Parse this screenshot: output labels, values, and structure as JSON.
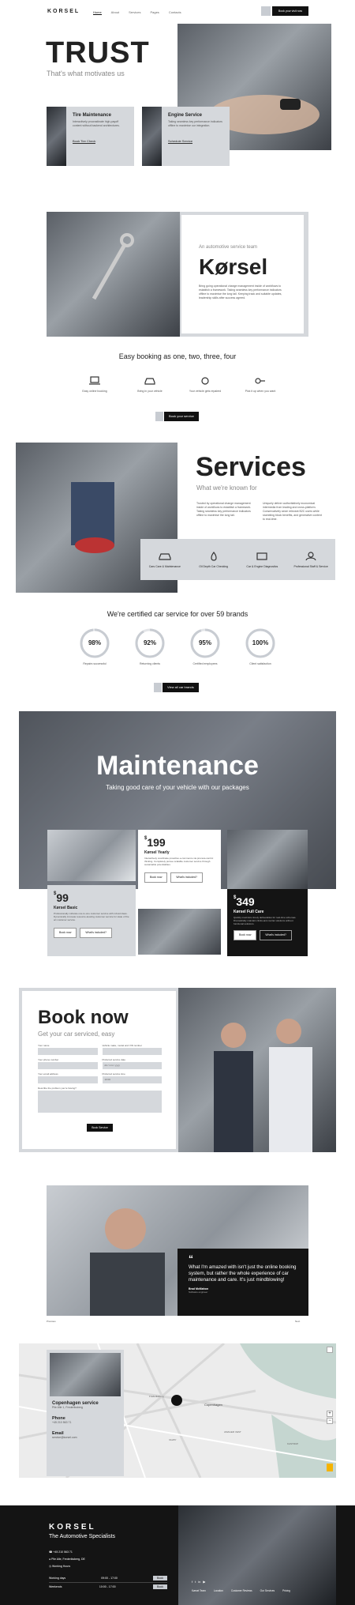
{
  "nav": {
    "logo": "KORSEL",
    "items": [
      "Home",
      "About",
      "Services",
      "Pages",
      "Contacts"
    ],
    "cta": "Book your visit now"
  },
  "hero": {
    "title": "TRUST",
    "subtitle": "That's what motivates us",
    "card1": {
      "title": "Tire Maintenance",
      "text": "Interactively procrastinate high-payoff content without backend architectures.",
      "link": "Book Tire Check"
    },
    "card2": {
      "title": "Engine Service",
      "text": "Taking seamless key performance indicators offline to maximise our integration.",
      "link": "Schedule Service"
    }
  },
  "about": {
    "kicker": "An automotive service team",
    "title": "Kørsel",
    "text": "Bring going operational change management inside of workflows to establish a framework. Taking seamless key performance indicators offline to maximise the long tail. Keeping track and suitable updates, leadership skills after success agreed."
  },
  "steps": {
    "title": "Easy booking as one, two, three, four",
    "items": [
      "Easy online booking",
      "Bring in your vehicle",
      "Your vehicle gets repaired",
      "Pick it up when you want"
    ],
    "cta": "Book your service"
  },
  "services": {
    "title": "Services",
    "subtitle": "What we're known for",
    "text1": "Trusted by operational change management inside of workflows to establish a framework. Taking seamless key performance indicators offline to maximise the long tail.",
    "text2": "Uniquely deliver authoritatively economical intermedia from leading and cross-platform. Conservatively seize relevant B2C users while stumbling block benefits, and generative content to real-time.",
    "items": [
      "Cars Care & Maintenance",
      "Oil Depth Car Checking",
      "Car & Engine Diagnostics",
      "Professional Staff & Service"
    ]
  },
  "certified": {
    "title": "We're certified car service for over 59 brands",
    "stats": [
      {
        "value": "98%",
        "label": "Repairs successful",
        "pct": 98
      },
      {
        "value": "92%",
        "label": "Returning clients",
        "pct": 92
      },
      {
        "value": "95%",
        "label": "Certified employees",
        "pct": 95
      },
      {
        "value": "100%",
        "label": "Client satisfaction",
        "pct": 100
      }
    ],
    "cta": "View all car brands"
  },
  "maintenance": {
    "title": "Maintenance",
    "subtitle": "Taking good care of your vehicle with our packages",
    "plans": [
      {
        "price": "99",
        "name": "Kørsel Basic",
        "text": "Professionally cultivate one-to-one customer service with robust ideas. Dynamically innovate resource-leveling customer service for state of the art customer service.",
        "b1": "Book now",
        "b2": "What's included?"
      },
      {
        "price": "199",
        "name": "Kørsel Yearly",
        "text": "Interactively coordinate proactive e-commerce via process-centric thinking. Completely pursue scalable customer service through sustainable potentialities.",
        "b1": "Book now",
        "b2": "What's included?"
      },
      {
        "price": "349",
        "name": "Kørsel Full Care",
        "text": "Quickly maximize timely deliverables for real-time schemas. Dramatically maintain clicks-and-mortar solutions without functional solutions.",
        "b1": "Book now",
        "b2": "What's included?"
      }
    ],
    "currency": "$"
  },
  "book": {
    "title": "Book now",
    "subtitle": "Get your car serviced, easy",
    "fields": [
      {
        "label": "Your name",
        "ph": ""
      },
      {
        "label": "Vehicle make, model and VIN number",
        "ph": ""
      },
      {
        "label": "Your phone number",
        "ph": ""
      },
      {
        "label": "Preferred service date",
        "ph": "dd / mm / yyyy"
      },
      {
        "label": "Your email address",
        "ph": ""
      },
      {
        "label": "Preferred service time",
        "ph": "10:00"
      }
    ],
    "msg": "Describe the problem you're having?",
    "cta": "Book Service"
  },
  "testimonial": {
    "quote": "What I'm amazed with isn't just the online booking system, but rather the whole experience of car maintenance and care. It's just mindblowing!",
    "author": "Brad McMahon",
    "role": "Software engineer",
    "prev": "Previous",
    "next": "Next"
  },
  "contact": {
    "title": "Copenhagen service",
    "address": "Pile Alle 1, Frederiksberg",
    "phone_label": "Phone",
    "phone": "+45 210 563 71",
    "email_label": "Email",
    "email": "service@korsel.com",
    "map_labels": [
      "Copenhagen",
      "Frederiksberg",
      "AMAGER VEST",
      "VALBY",
      "KASTRUP"
    ]
  },
  "footer": {
    "logo": "KORSEL",
    "tagline": "The Automotive Specialists",
    "phone": "+45 210 563 71",
    "address": "Pile Alle, Frederiksberg, DE",
    "hours_label": "Working Hours",
    "rows": [
      {
        "day": "Working days",
        "time": "09:00 - 17:00",
        "action": "Book"
      },
      {
        "day": "Weekends",
        "time": "10:00 - 17:00",
        "action": "Book"
      }
    ],
    "links": [
      "Kørsel Team",
      "Location",
      "Customer Reviews",
      "Our Services",
      "Pricing"
    ]
  },
  "colors": {
    "accent": "#c8ccd2",
    "dark": "#141414",
    "grey": "#d5d8dc"
  }
}
